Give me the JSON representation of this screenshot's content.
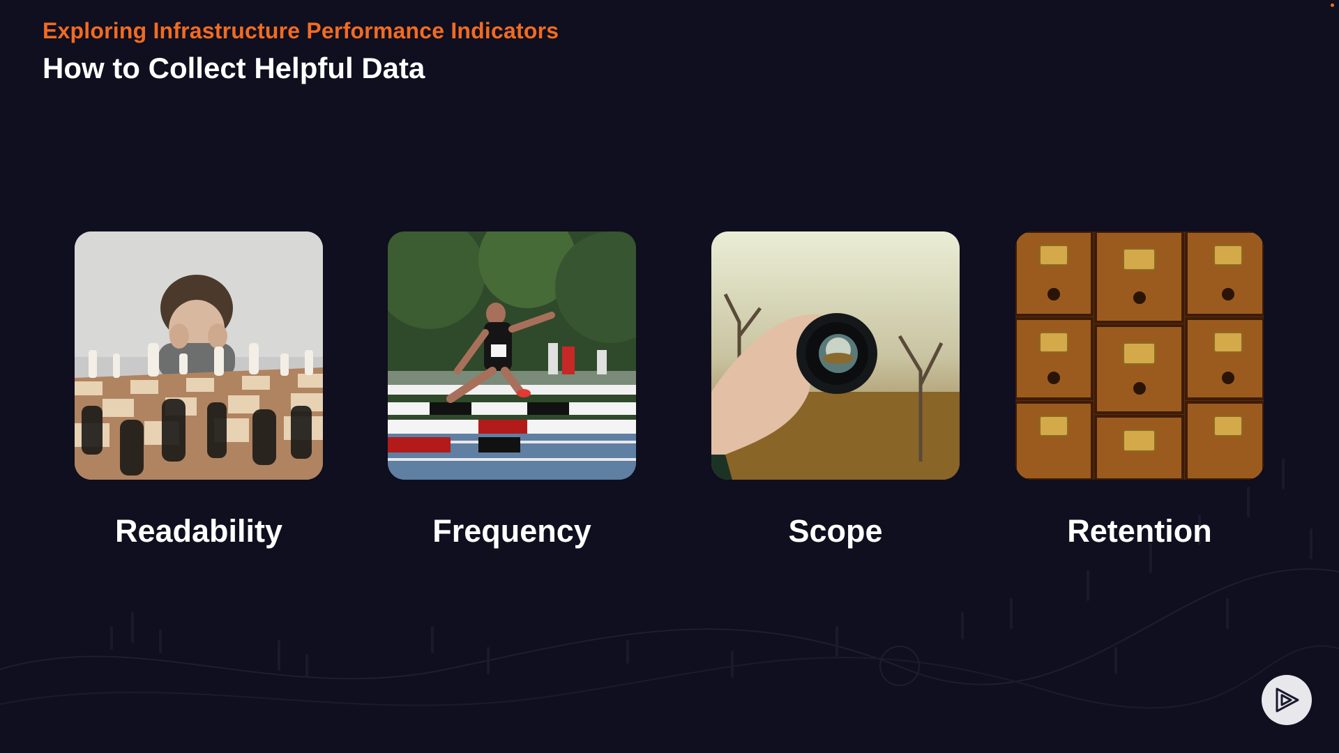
{
  "header": {
    "subtitle": "Exploring Infrastructure Performance Indicators",
    "title": "How to Collect Helpful Data"
  },
  "cards": [
    {
      "label": "Readability",
      "image": "boy-looking-at-chessboard-photo"
    },
    {
      "label": "Frequency",
      "image": "hurdles-runner-photo"
    },
    {
      "label": "Scope",
      "image": "hand-holding-camera-lens-photo"
    },
    {
      "label": "Retention",
      "image": "card-catalog-drawers-photo"
    }
  ],
  "colors": {
    "background": "#0f0f1f",
    "accent": "#f26b21",
    "text": "#ffffff"
  },
  "branding": {
    "logo": "play-logo-icon"
  }
}
